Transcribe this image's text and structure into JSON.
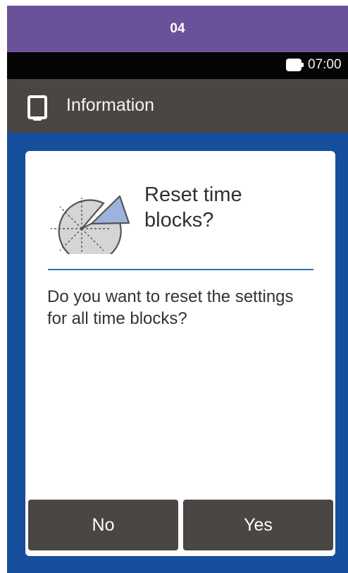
{
  "banner": {
    "label": "04",
    "color": "#6B5199"
  },
  "status_bar": {
    "battery_icon": "battery-icon",
    "time": "07:00"
  },
  "header": {
    "icon": "device-icon",
    "title": "Information"
  },
  "dialog": {
    "icon": "pie-chart-icon",
    "title": "Reset time blocks?",
    "message": "Do you want to reset the settings for all time blocks?",
    "buttons": {
      "no_label": "No",
      "yes_label": "Yes"
    }
  },
  "colors": {
    "screen_background": "#164F9B",
    "header_background": "#4A4644",
    "status_background": "#050505",
    "divider": "#2F6DB9",
    "button_background": "#4A4644",
    "icon_slice": "#9DB3DD"
  }
}
